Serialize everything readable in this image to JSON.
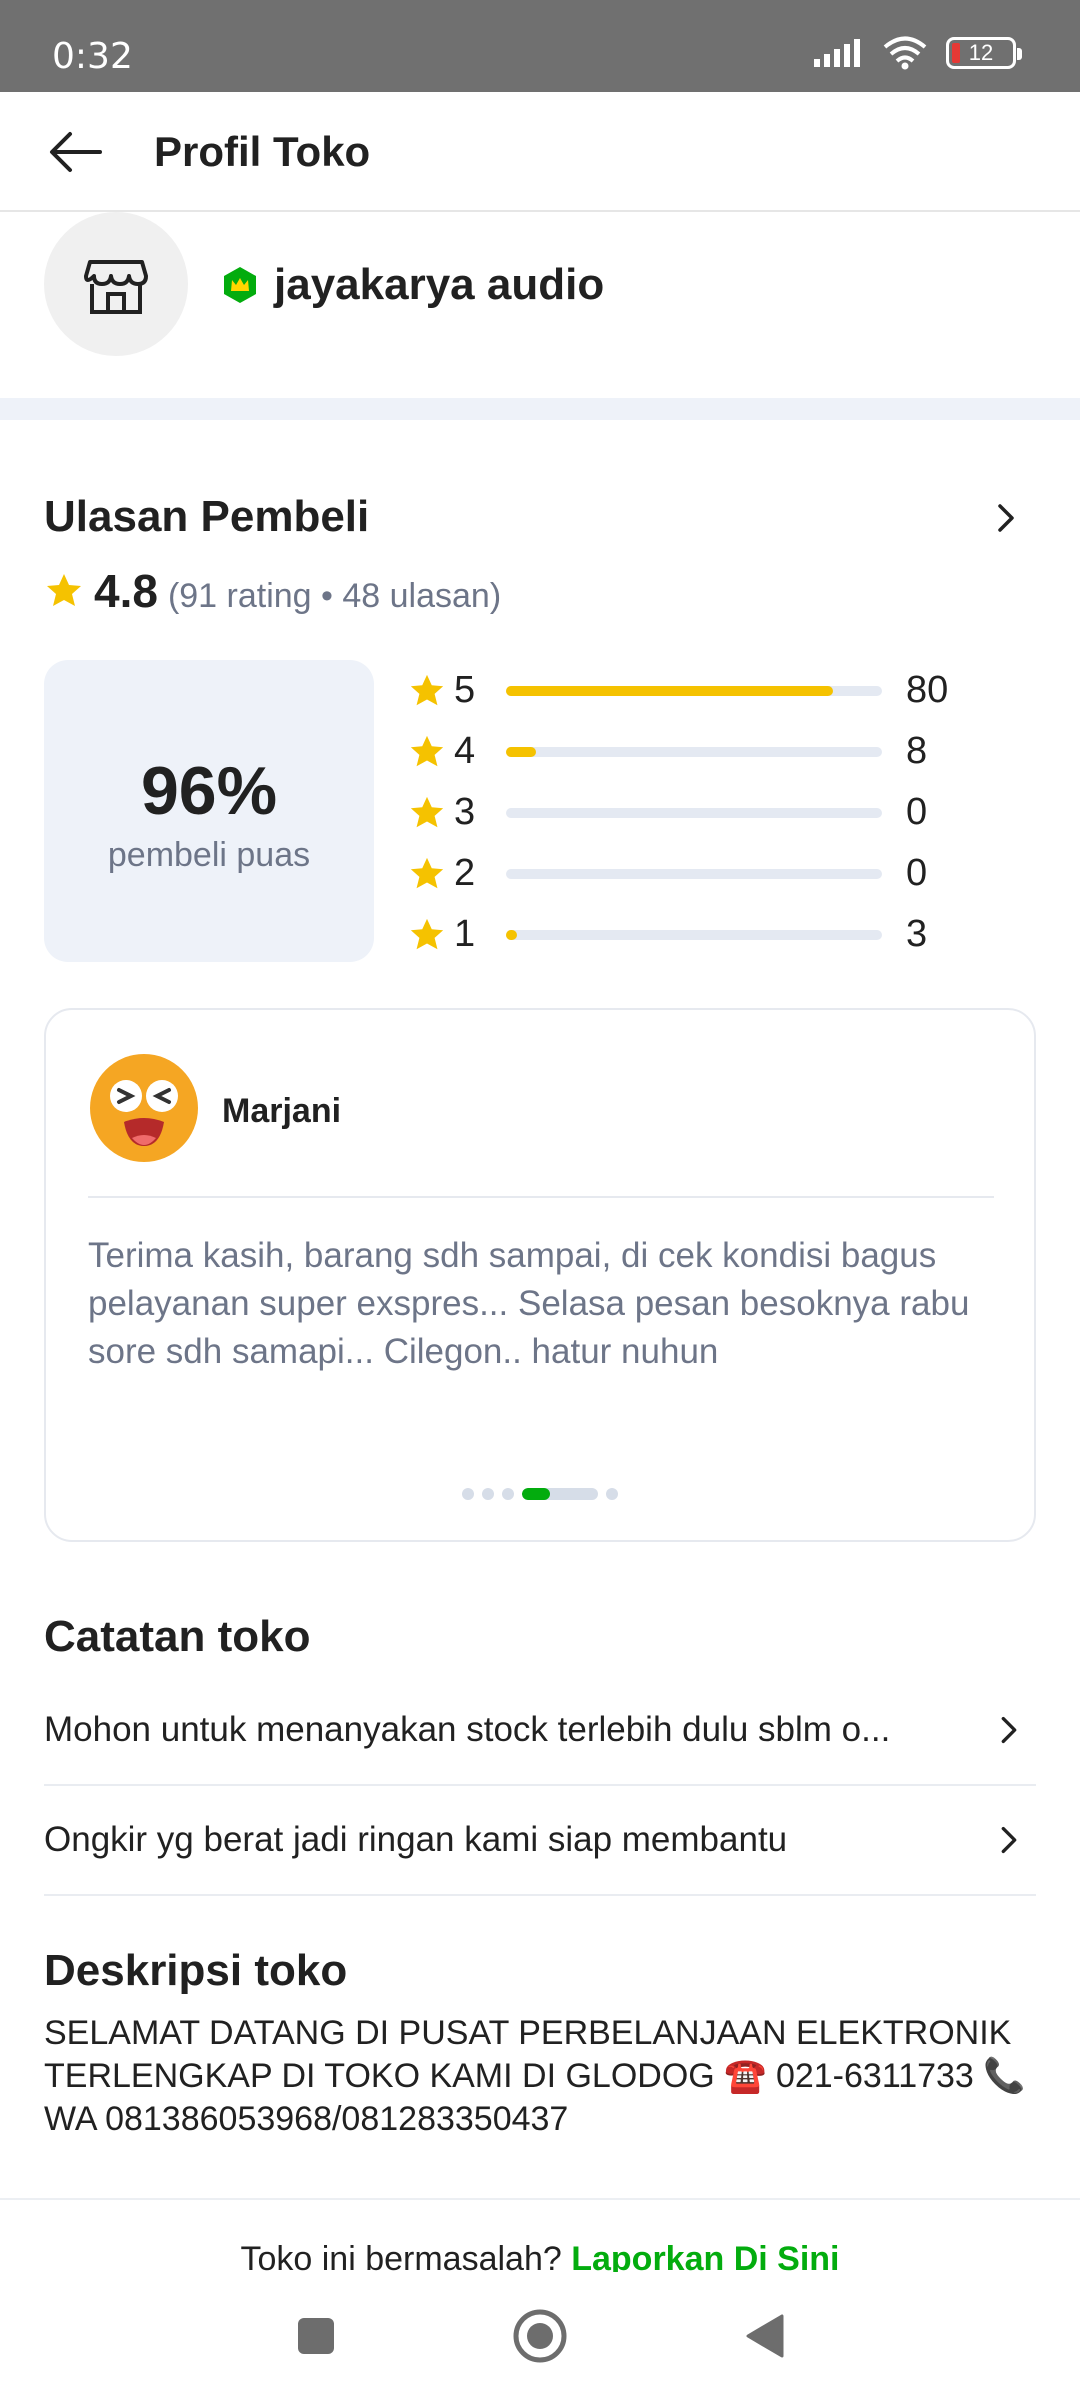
{
  "status_bar": {
    "time": "0:32",
    "battery": "12"
  },
  "header": {
    "title": "Profil Toko"
  },
  "shop": {
    "name": "jayakarya audio"
  },
  "reviews": {
    "title": "Ulasan Pembeli",
    "rating": "4.8",
    "detail": "(91 rating • 48 ulasan)",
    "satisfaction_pct": "96%",
    "satisfaction_label": "pembeli puas",
    "distribution": [
      {
        "stars": "5",
        "count": "80",
        "fraction": 0.87
      },
      {
        "stars": "4",
        "count": "8",
        "fraction": 0.08
      },
      {
        "stars": "3",
        "count": "0",
        "fraction": 0
      },
      {
        "stars": "2",
        "count": "0",
        "fraction": 0
      },
      {
        "stars": "1",
        "count": "3",
        "fraction": 0.03
      }
    ],
    "card": {
      "reviewer": "Marjani",
      "text": "Terima kasih, barang sdh sampai, di cek kondisi bagus pelayanan super exspres... Selasa pesan besoknya rabu sore sdh samapi... Cilegon.. hatur nuhun"
    }
  },
  "notes": {
    "title": "Catatan toko",
    "items": [
      "Mohon untuk menanyakan stock terlebih dulu sblm o...",
      "Ongkir yg berat jadi ringan kami siap membantu"
    ]
  },
  "description": {
    "title": "Deskripsi toko",
    "text": "SELAMAT DATANG DI PUSAT PERBELANJAAN ELEKTRONIK TERLENGKAP DI TOKO KAMI DI GLODOG ☎️ 021-6311733 📞 WA 081386053968/081283350437"
  },
  "footer": {
    "question": "Toko ini bermasalah?",
    "link": "Laporkan Di Sini"
  },
  "colors": {
    "accent_green": "#03ac0e",
    "star_yellow": "#f5c200",
    "muted_text": "#6d7588"
  }
}
